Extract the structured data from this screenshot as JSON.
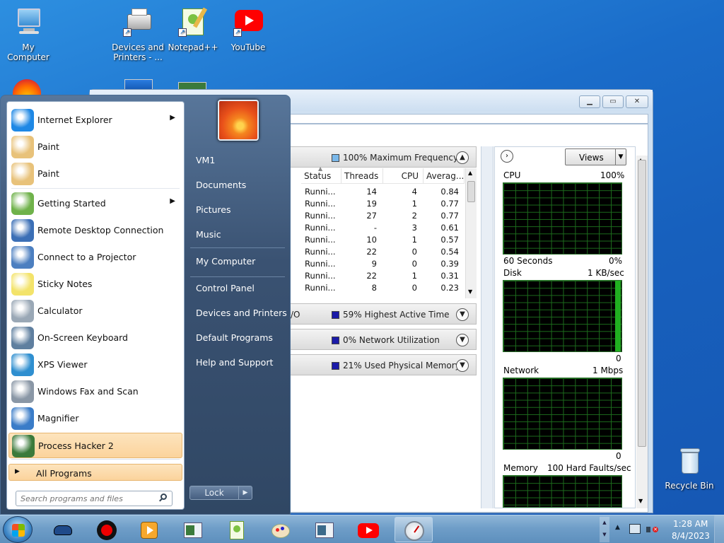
{
  "desktop": {
    "icons": [
      {
        "label": "My Computer"
      },
      {
        "label": "Devices and Printers - ..."
      },
      {
        "label": "Notepad++"
      },
      {
        "label": "YouTube"
      },
      {
        "label": "Recycle Bin"
      }
    ]
  },
  "resmon": {
    "cpu_header": "100% Maximum Frequency",
    "disk_header_partial": "/O",
    "disk_header": "59% Highest Active Time",
    "network_header": "0% Network Utilization",
    "memory_header": "21% Used Physical Memory",
    "columns": [
      "Status",
      "Threads",
      "CPU",
      "Averag..."
    ],
    "rows": [
      {
        "status": "Runni...",
        "threads": "14",
        "cpu": "4",
        "avg": "0.84"
      },
      {
        "status": "Runni...",
        "threads": "19",
        "cpu": "1",
        "avg": "0.77"
      },
      {
        "status": "Runni...",
        "threads": "27",
        "cpu": "2",
        "avg": "0.77"
      },
      {
        "status": "Runni...",
        "threads": "-",
        "cpu": "3",
        "avg": "0.61"
      },
      {
        "status": "Runni...",
        "threads": "10",
        "cpu": "1",
        "avg": "0.57"
      },
      {
        "status": "Runni...",
        "threads": "22",
        "cpu": "0",
        "avg": "0.54"
      },
      {
        "status": "Runni...",
        "threads": "9",
        "cpu": "0",
        "avg": "0.39"
      },
      {
        "status": "Runni...",
        "threads": "22",
        "cpu": "1",
        "avg": "0.31"
      },
      {
        "status": "Runni...",
        "threads": "8",
        "cpu": "0",
        "avg": "0.23"
      }
    ],
    "views_label": "Views",
    "graphs": {
      "cpu": {
        "label": "CPU",
        "max": "100%",
        "bottom_left": "60 Seconds",
        "bottom_right": "0%"
      },
      "disk": {
        "label": "Disk",
        "max": "1 KB/sec",
        "bottom_right": "0"
      },
      "network": {
        "label": "Network",
        "max": "1 Mbps",
        "bottom_right": "0"
      },
      "memory": {
        "label": "Memory",
        "max": "100 Hard Faults/sec"
      }
    }
  },
  "start_menu": {
    "left_items": [
      {
        "label": "Internet Explorer",
        "icon": "ie-icon",
        "has_arrow": true
      },
      {
        "label": "Paint",
        "icon": "paint-icon"
      },
      {
        "label": "Paint",
        "icon": "paint-icon"
      },
      {
        "label": "Getting Started",
        "icon": "getting-started-icon",
        "has_arrow": true
      },
      {
        "label": "Remote Desktop Connection",
        "icon": "remote-desktop-icon"
      },
      {
        "label": "Connect to a Projector",
        "icon": "projector-icon"
      },
      {
        "label": "Sticky Notes",
        "icon": "sticky-notes-icon"
      },
      {
        "label": "Calculator",
        "icon": "calculator-icon"
      },
      {
        "label": "On-Screen Keyboard",
        "icon": "keyboard-icon"
      },
      {
        "label": "XPS Viewer",
        "icon": "xps-viewer-icon"
      },
      {
        "label": "Windows Fax and Scan",
        "icon": "fax-scan-icon"
      },
      {
        "label": "Magnifier",
        "icon": "magnifier-icon"
      },
      {
        "label": "Process Hacker 2",
        "icon": "process-hacker-icon",
        "highlighted": true
      }
    ],
    "all_programs": "All Programs",
    "search_placeholder": "Search programs and files",
    "right_items": [
      "VM1",
      "Documents",
      "Pictures",
      "Music",
      "My Computer",
      "Control Panel",
      "Devices and Printers",
      "Default Programs",
      "Help and Support"
    ],
    "lock_label": "Lock"
  },
  "taskbar": {
    "time": "1:28 AM",
    "date": "8/4/2023"
  },
  "colors": {
    "desktop": "#1a6cc9",
    "graph_bg": "#000000",
    "graph_grid": "#1c6b1c",
    "highlight": "#fbd39c"
  }
}
